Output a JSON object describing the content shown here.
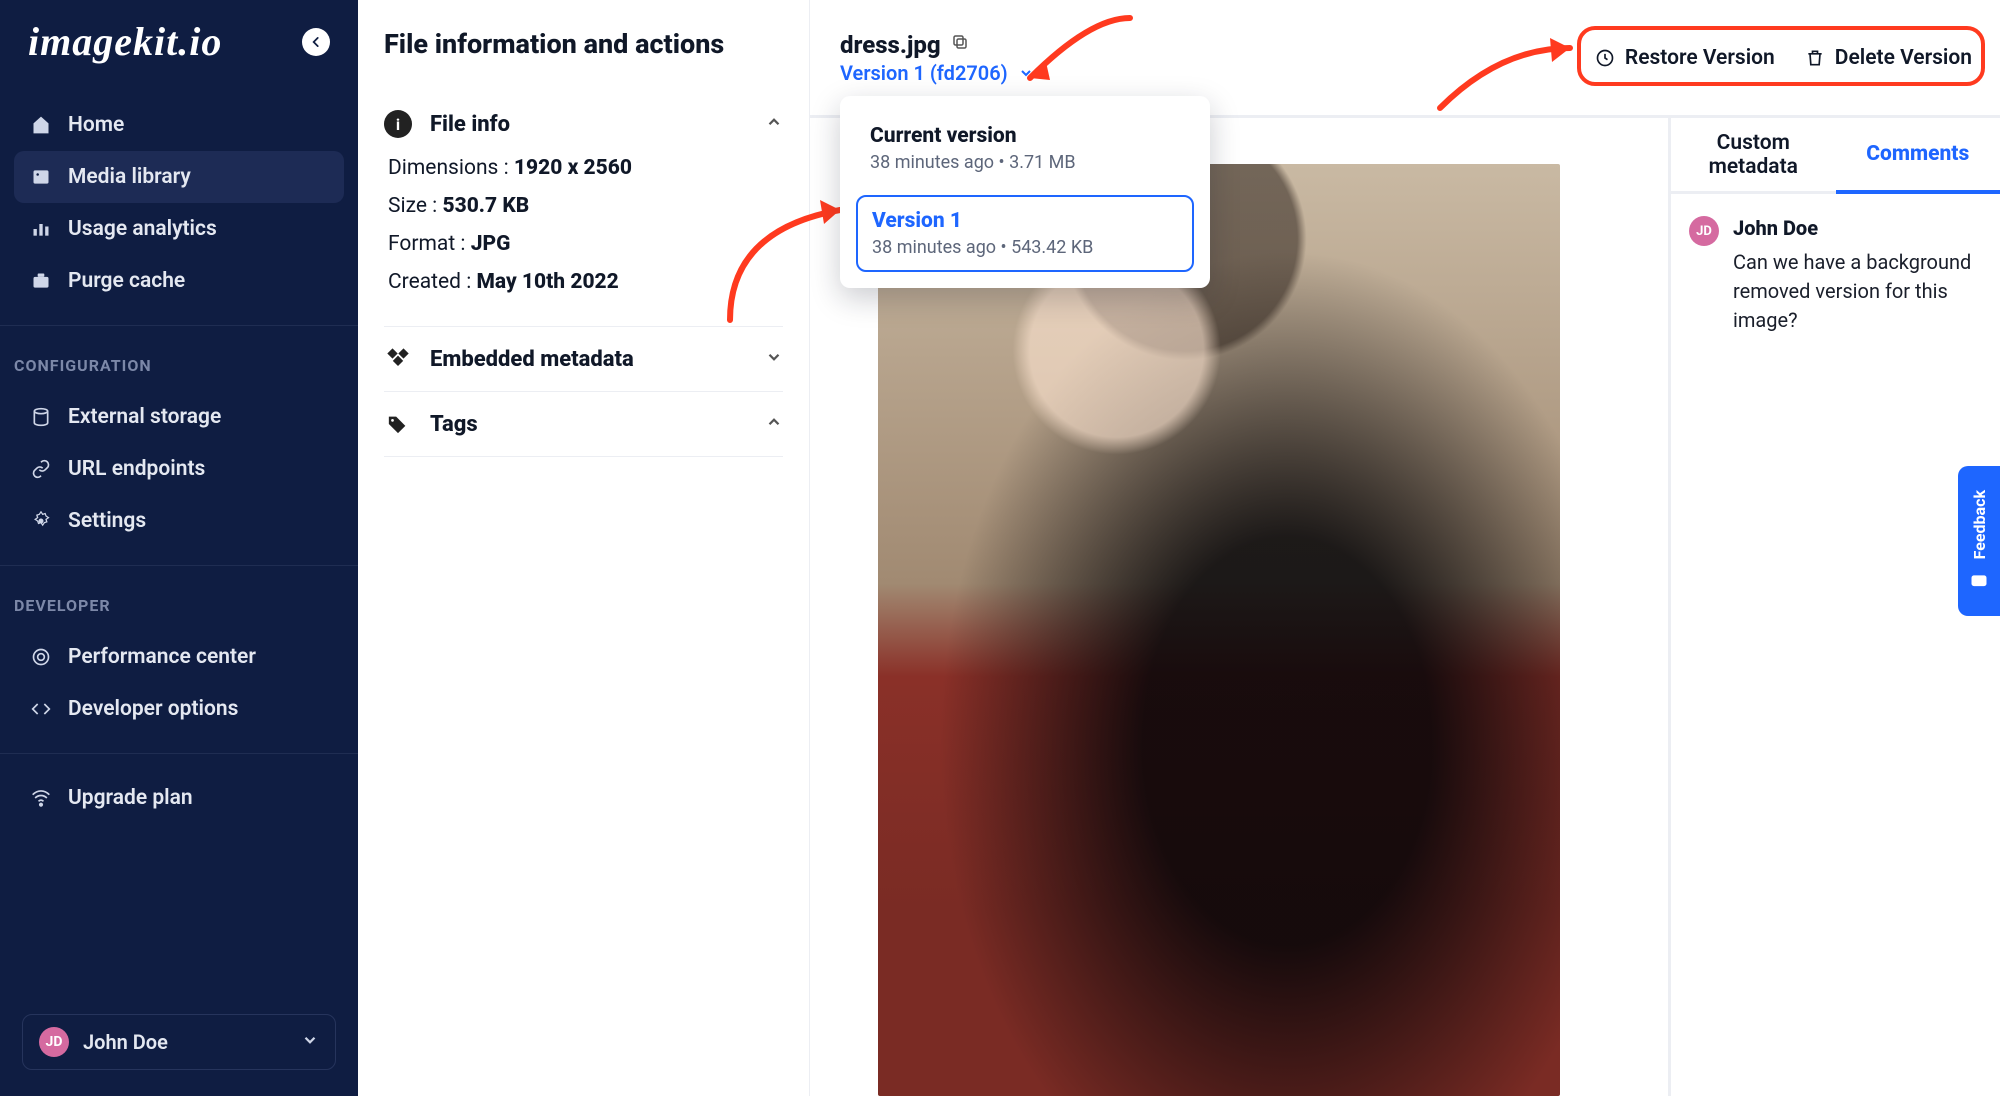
{
  "brand": "imagekit.io",
  "sidebar": {
    "items": [
      {
        "ico": "home",
        "label": "Home"
      },
      {
        "ico": "media",
        "label": "Media library"
      },
      {
        "ico": "chart",
        "label": "Usage analytics"
      },
      {
        "ico": "cache",
        "label": "Purge cache"
      }
    ],
    "config_heading": "CONFIGURATION",
    "config_items": [
      {
        "ico": "storage",
        "label": "External storage"
      },
      {
        "ico": "link",
        "label": "URL endpoints"
      },
      {
        "ico": "gear",
        "label": "Settings"
      }
    ],
    "dev_heading": "DEVELOPER",
    "dev_items": [
      {
        "ico": "perf",
        "label": "Performance center"
      },
      {
        "ico": "code",
        "label": "Developer options"
      }
    ],
    "upgrade_label": "Upgrade plan"
  },
  "user": {
    "initials": "JD",
    "name": "John Doe"
  },
  "info": {
    "title": "File information and actions",
    "section_file": "File info",
    "dimensions_label": "Dimensions : ",
    "dimensions_value": "1920 x 2560",
    "size_label": "Size :  ",
    "size_value": "530.7 KB",
    "format_label": "Format : ",
    "format_value": "JPG",
    "created_label": "Created :  ",
    "created_value": "May 10th 2022",
    "section_meta": "Embedded metadata",
    "section_tags": "Tags"
  },
  "file": {
    "name": "dress.jpg",
    "version_link": "Version 1 (fd2706)"
  },
  "versions": {
    "current_title": "Current version",
    "current_sub": "38 minutes ago • 3.71 MB",
    "v1_title": "Version 1",
    "v1_sub": "38 minutes ago • 543.42 KB"
  },
  "actions": {
    "restore": "Restore Version",
    "delete": "Delete Version"
  },
  "tabs": {
    "metadata": "Custom metadata",
    "comments": "Comments"
  },
  "comment": {
    "author_initials": "JD",
    "author": "John Doe",
    "text": "Can we have a background removed version for this image?"
  },
  "feedback_label": "Feedback"
}
